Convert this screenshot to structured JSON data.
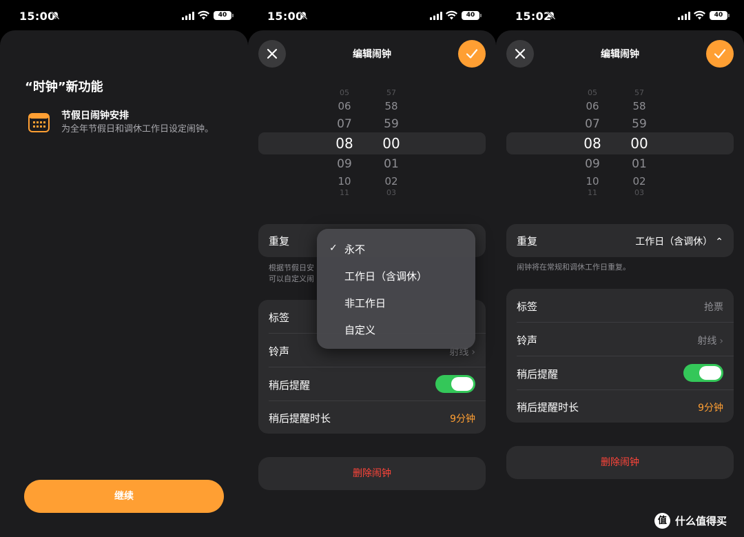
{
  "screens": [
    {
      "time": "15:00",
      "battery": "40"
    },
    {
      "time": "15:00",
      "battery": "40"
    },
    {
      "time": "15:02",
      "battery": "40"
    }
  ],
  "intro": {
    "title": "“时钟”新功能",
    "feature_name": "节假日闹钟安排",
    "feature_desc": "为全年节假日和调休工作日设定闹钟。",
    "continue_label": "继续"
  },
  "edit": {
    "title": "编辑闹钟",
    "picker": {
      "hours": [
        "05",
        "06",
        "07",
        "08",
        "09",
        "10",
        "11"
      ],
      "minutes": [
        "57",
        "58",
        "59",
        "00",
        "01",
        "02",
        "03"
      ]
    },
    "repeat_label": "重复",
    "label_label": "标签",
    "sound_label": "铃声",
    "snooze_label": "稍后提醒",
    "snooze_duration_label": "稍后提醒时长",
    "sound_value": "射线",
    "snooze_duration_value": "9分钟",
    "delete_label": "删除闹钟"
  },
  "screen2": {
    "hint_lines": [
      "根据节假日安",
      "可以自定义闹"
    ],
    "menu": {
      "items": [
        "永不",
        "工作日（含调休）",
        "非工作日",
        "自定义"
      ],
      "checked_index": 0
    }
  },
  "screen3": {
    "repeat_value": "工作日（含调休）",
    "hint": "闹钟将在常规和调休工作日重复。",
    "label_value": "抢票"
  },
  "watermark": {
    "text": "什么值得买",
    "logo": "值"
  },
  "colors": {
    "accent": "#ff9f33",
    "toggle_on": "#34c759",
    "destructive": "#ff453a",
    "card": "#2c2c2e",
    "sheet": "#1c1c1e"
  }
}
